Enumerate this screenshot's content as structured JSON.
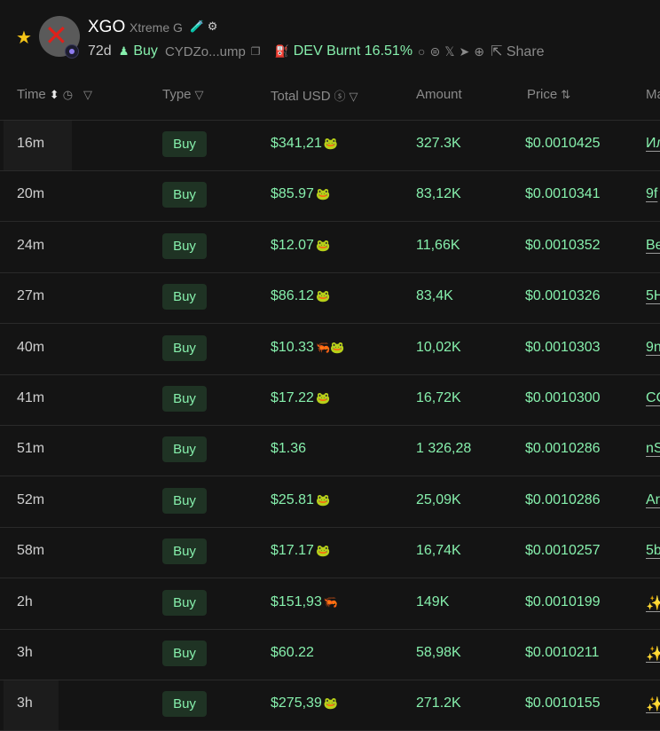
{
  "token": {
    "symbol": "XGO",
    "name": "Xtreme G",
    "badge_icons": "🧪 ⚙",
    "age": "72d",
    "buy_label": "Buy",
    "address": "CYDZo...ump",
    "dev_status": "DEV Burnt 16.51%",
    "share_label": "Share",
    "social_icons": [
      "search-icon",
      "pump-icon",
      "x-icon",
      "telegram-icon",
      "globe-icon"
    ]
  },
  "columns": {
    "time": "Time",
    "type": "Type",
    "total_usd": "Total USD",
    "amount": "Amount",
    "price": "Price",
    "maker": "Ma"
  },
  "rows": [
    {
      "time": "16m",
      "type": "Buy",
      "usd": "$341,21",
      "emoji": "🐸",
      "amount": "327.3K",
      "price": "$0.0010425",
      "maker": "Ил"
    },
    {
      "time": "20m",
      "type": "Buy",
      "usd": "$85.97",
      "emoji": "🐸",
      "amount": "83,12K",
      "price": "$0.0010341",
      "maker": "9f"
    },
    {
      "time": "24m",
      "type": "Buy",
      "usd": "$12.07",
      "emoji": "🐸",
      "amount": "11,66K",
      "price": "$0.0010352",
      "maker": "Be"
    },
    {
      "time": "27m",
      "type": "Buy",
      "usd": "$86.12",
      "emoji": "🐸",
      "amount": "83,4K",
      "price": "$0.0010326",
      "maker": "5H"
    },
    {
      "time": "40m",
      "type": "Buy",
      "usd": "$10.33",
      "emoji": "🦐🐸",
      "amount": "10,02K",
      "price": "$0.0010303",
      "maker": "9n"
    },
    {
      "time": "41m",
      "type": "Buy",
      "usd": "$17.22",
      "emoji": "🐸",
      "amount": "16,72K",
      "price": "$0.0010300",
      "maker": "CC"
    },
    {
      "time": "51m",
      "type": "Buy",
      "usd": "$1.36",
      "emoji": "",
      "amount": "1 326,28",
      "price": "$0.0010286",
      "maker": "nS"
    },
    {
      "time": "52m",
      "type": "Buy",
      "usd": "$25.81",
      "emoji": "🐸",
      "amount": "25,09K",
      "price": "$0.0010286",
      "maker": "Ar"
    },
    {
      "time": "58m",
      "type": "Buy",
      "usd": "$17.17",
      "emoji": "🐸",
      "amount": "16,74K",
      "price": "$0.0010257",
      "maker": "5b"
    },
    {
      "time": "2h",
      "type": "Buy",
      "usd": "$151,93",
      "emoji": "🦐",
      "amount": "149K",
      "price": "$0.0010199",
      "maker": "✨"
    },
    {
      "time": "3h",
      "type": "Buy",
      "usd": "$60.22",
      "emoji": "",
      "amount": "58,98K",
      "price": "$0.0010211",
      "maker": "✨"
    },
    {
      "time": "3h",
      "type": "Buy",
      "usd": "$275,39",
      "emoji": "🐸",
      "amount": "271.2K",
      "price": "$0.0010155",
      "maker": "✨"
    }
  ],
  "colors": {
    "background": "#141414",
    "buy_green": "#86efac",
    "buy_badge_bg": "#1f3324",
    "muted": "#8a8a8a",
    "star": "#f5c518"
  }
}
